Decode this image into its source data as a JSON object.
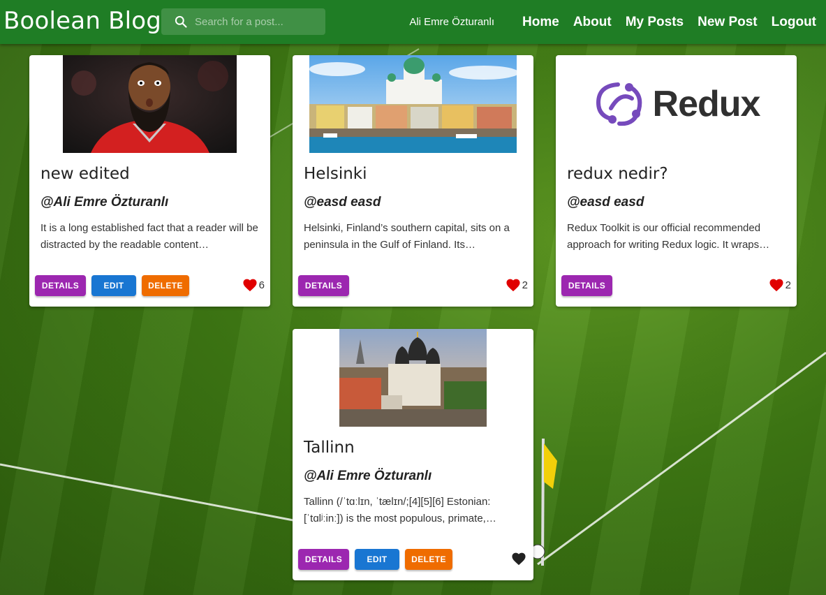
{
  "header": {
    "brand": "Boolean Blog",
    "search_placeholder": "Search for a post...",
    "username": "Ali Emre Özturanlı",
    "nav": [
      "Home",
      "About",
      "My Posts",
      "New Post",
      "Logout"
    ]
  },
  "buttons": {
    "details": "DETAILS",
    "edit": "EDIT",
    "delete": "DELETE"
  },
  "posts": [
    {
      "title": "new edited",
      "author": "@Ali Emre Özturanlı",
      "excerpt": "It is a long established fact that a reader will be distracted by the readable content…",
      "likes": "6",
      "liked": true,
      "image": "bearded-basketball-player-photo"
    },
    {
      "title": "Helsinki",
      "author": "@easd easd",
      "excerpt": "Helsinki, Finland’s southern capital, sits on a peninsula in the Gulf of Finland. Its…",
      "likes": "2",
      "liked": true,
      "image": "helsinki-harbour-photo"
    },
    {
      "title": "redux nedir?",
      "author": "@easd easd",
      "excerpt": "Redux Toolkit is our official recommended approach for writing Redux logic. It wraps…",
      "likes": "2",
      "liked": true,
      "image": "redux-logo",
      "logo_text": "Redux"
    },
    {
      "title": "Tallinn",
      "author": "@Ali Emre Özturanlı",
      "excerpt": "Tallinn (/ˈtɑːlɪn, ˈtælɪn/;[4][5][6] Estonian: [ˈtɑlʲːinː]) is the most populous, primate,…",
      "likes": "",
      "liked": false,
      "image": "tallinn-cathedral-photo"
    }
  ],
  "colors": {
    "appbar": "#1f7d25",
    "details": "#9c27b0",
    "edit": "#1976d2",
    "delete": "#ef6c00",
    "heart_liked": "#e00000",
    "heart_unliked": "#222222"
  }
}
